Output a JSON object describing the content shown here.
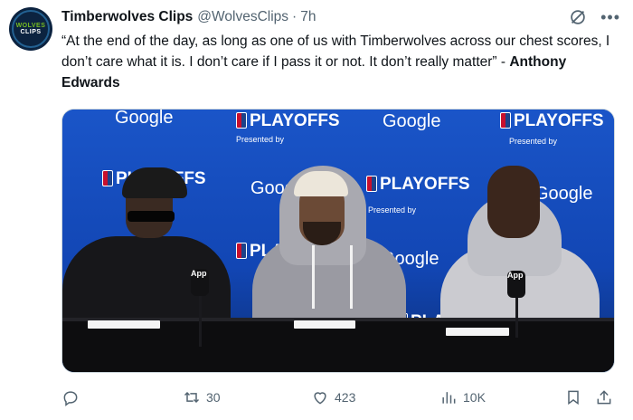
{
  "account": {
    "name": "Timberwolves Clips",
    "handle": "@WolvesClips",
    "separator": "·",
    "time": "7h",
    "avatar_text_1": "WOLVES",
    "avatar_text_2": "CLIPS"
  },
  "tweet": {
    "text_main": "“At the end of the day, as long as one of us with Timberwolves across our chest scores, I don’t care what it is. I don’t care if I pass it or not. It don’t really matter” - ",
    "text_bold": "Anthony Edwards"
  },
  "media": {
    "backdrop_logos": [
      "PLAYOFFS",
      "Google"
    ],
    "presented_by": "Presented by",
    "mic_tag": "App",
    "backdrop_color": "#1a55c8"
  },
  "actions": {
    "reply": {
      "icon": "reply-icon",
      "count": ""
    },
    "retweet": {
      "icon": "retweet-icon",
      "count": "30"
    },
    "like": {
      "icon": "heart-icon",
      "count": "423"
    },
    "views": {
      "icon": "views-icon",
      "count": "10K"
    },
    "bookmark": {
      "icon": "bookmark-icon"
    },
    "share": {
      "icon": "share-icon"
    }
  },
  "header_icons": [
    "grok-icon",
    "more-icon"
  ],
  "colors": {
    "text": "#0f1419",
    "muted": "#536471",
    "border": "#cfd9de"
  }
}
